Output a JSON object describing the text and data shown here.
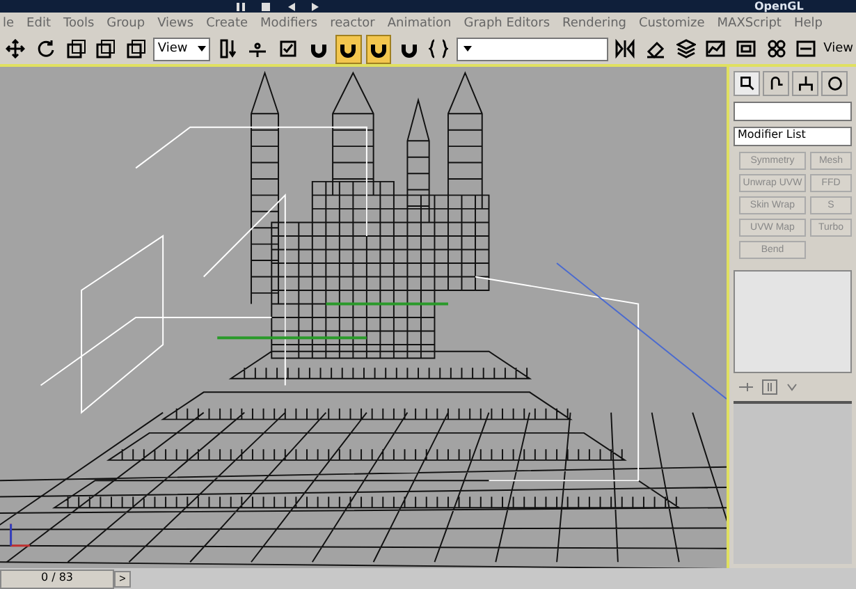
{
  "title_bar": {
    "label": "OpenGL",
    "media_buttons": [
      {
        "kind": "pause"
      },
      {
        "kind": "stop"
      },
      {
        "kind": "prev"
      },
      {
        "kind": "next"
      }
    ]
  },
  "menu": [
    "le",
    "Edit",
    "Tools",
    "Group",
    "Views",
    "Create",
    "Modifiers",
    "reactor",
    "Animation",
    "Graph Editors",
    "Rendering",
    "Customize",
    "MAXScript",
    "Help"
  ],
  "toolbar": [
    {
      "kind": "move",
      "on": false
    },
    {
      "kind": "rotate",
      "on": false
    },
    {
      "kind": "scale",
      "on": false
    },
    {
      "kind": "scale",
      "on": false
    },
    {
      "kind": "scale",
      "on": false
    },
    {
      "kind": "dropdown",
      "value": "View"
    },
    {
      "kind": "pivot",
      "on": false
    },
    {
      "kind": "axis",
      "on": false
    },
    {
      "kind": "check",
      "on": false
    },
    {
      "kind": "magnet",
      "on": false
    },
    {
      "kind": "magnet",
      "on": true
    },
    {
      "kind": "magnet",
      "on": true
    },
    {
      "kind": "magnet",
      "on": false
    },
    {
      "kind": "braces",
      "on": false
    },
    {
      "kind": "dropdown"
    },
    {
      "kind": "mirror",
      "on": false
    },
    {
      "kind": "align",
      "on": false
    },
    {
      "kind": "layers",
      "on": false
    },
    {
      "kind": "graph",
      "on": false
    },
    {
      "kind": "schematic",
      "on": false
    },
    {
      "kind": "material",
      "on": false
    },
    {
      "kind": "render",
      "on": false
    },
    {
      "kind": "label",
      "value": "View"
    }
  ],
  "command_panel": {
    "tabs": [
      {
        "selected": true
      },
      {
        "selected": false
      },
      {
        "selected": false
      },
      {
        "selected": false
      }
    ],
    "modifier_list": "Modifier List",
    "modifiers": [
      "Symmetry",
      "Mesh",
      "Unwrap UVW",
      "FFD",
      "Skin Wrap",
      "S",
      "UVW Map",
      "Turbo",
      "Bend"
    ]
  },
  "time_slider": {
    "frame": "0 / 83",
    "level": 0,
    "next": ">"
  }
}
